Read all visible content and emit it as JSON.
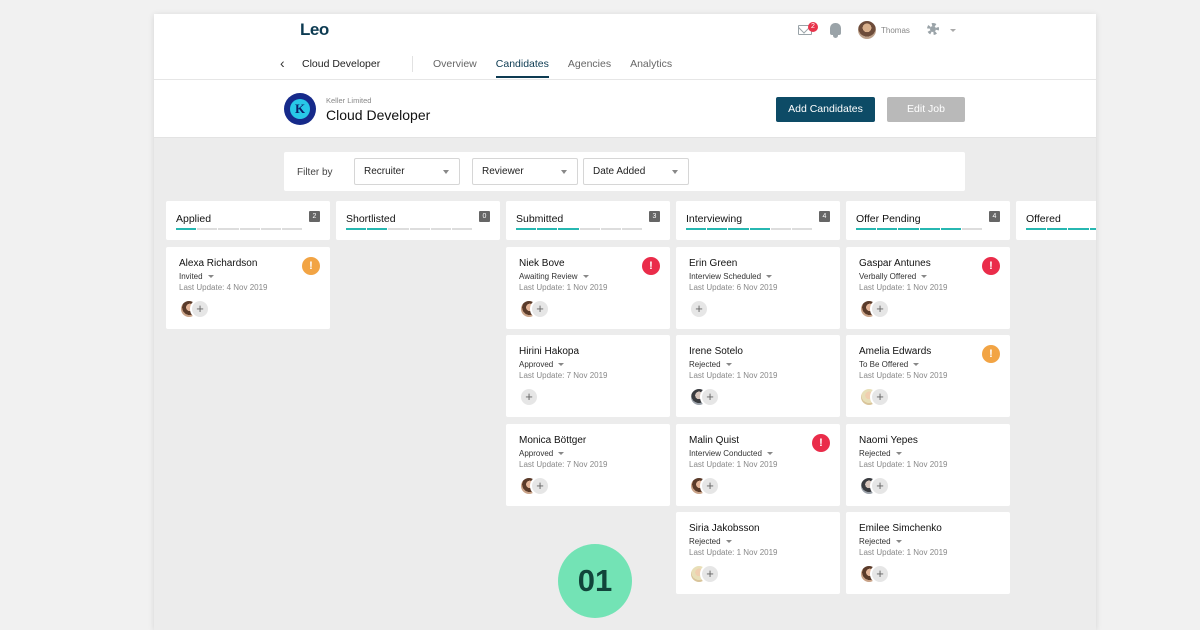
{
  "header": {
    "logo": "Leo",
    "job_crumb": "Cloud Developer",
    "tabs": [
      {
        "label": "Overview",
        "active": false
      },
      {
        "label": "Candidates",
        "active": true
      },
      {
        "label": "Agencies",
        "active": false
      },
      {
        "label": "Analytics",
        "active": false
      }
    ],
    "mail_count": "2",
    "user_name": "Thomas"
  },
  "job": {
    "company_initial": "K",
    "company": "Keller Limited",
    "title": "Cloud Developer",
    "add_button": "Add Candidates",
    "edit_button": "Edit Job"
  },
  "filters": {
    "label": "Filter by",
    "options": [
      "Recruiter",
      "Reviewer",
      "Date Added"
    ]
  },
  "columns": [
    {
      "title": "Applied",
      "count": "2"
    },
    {
      "title": "Shortlisted",
      "count": "0"
    },
    {
      "title": "Submitted",
      "count": "3"
    },
    {
      "title": "Interviewing",
      "count": "4"
    },
    {
      "title": "Offer Pending",
      "count": "4"
    },
    {
      "title": "Offered",
      "count": ""
    }
  ],
  "cards": {
    "applied": [
      {
        "name": "Alexa Richardson",
        "status": "Invited",
        "update": "Last Update: 4 Nov 2019",
        "alert": "!"
      }
    ],
    "submitted": [
      {
        "name": "Niek Bove",
        "status": "Awaiting Review",
        "update": "Last Update: 1 Nov 2019",
        "alert": "!"
      },
      {
        "name": "Hirini Hakopa",
        "status": "Approved",
        "update": "Last Update: 7 Nov 2019"
      },
      {
        "name": "Monica Böttger",
        "status": "Approved",
        "update": "Last Update: 7 Nov 2019"
      }
    ],
    "interviewing": [
      {
        "name": "Erin Green",
        "status": "Interview Scheduled",
        "update": "Last Update: 6 Nov 2019"
      },
      {
        "name": "Irene Sotelo",
        "status": "Rejected",
        "update": "Last Update: 1 Nov 2019"
      },
      {
        "name": "Malin Quist",
        "status": "Interview Conducted",
        "update": "Last Update: 1 Nov 2019",
        "alert": "!"
      },
      {
        "name": "Siria Jakobsson",
        "status": "Rejected",
        "update": "Last Update: 1 Nov 2019"
      }
    ],
    "offer_pending": [
      {
        "name": "Gaspar Antunes",
        "status": "Verbally Offered",
        "update": "Last Update: 1 Nov 2019",
        "alert": "!"
      },
      {
        "name": "Amelia Edwards",
        "status": "To Be Offered",
        "update": "Last Update: 5 Nov 2019",
        "alert": "!"
      },
      {
        "name": "Naomi Yepes",
        "status": "Rejected",
        "update": "Last Update: 1 Nov 2019"
      },
      {
        "name": "Emilee Simchenko",
        "status": "Rejected",
        "update": "Last Update: 1 Nov 2019"
      }
    ]
  },
  "plus_label": "+",
  "step_badge": "01",
  "colors": {
    "primary": "#0d4b66",
    "progress": "#27b7b1",
    "alert_red": "#ea2c4a",
    "alert_orange": "#f2a444",
    "badge": "#73e3b5"
  },
  "icons": [
    "chevron-left-icon",
    "mail-icon",
    "bell-icon",
    "gear-icon",
    "chevron-down-icon",
    "alert-icon",
    "plus-icon"
  ]
}
